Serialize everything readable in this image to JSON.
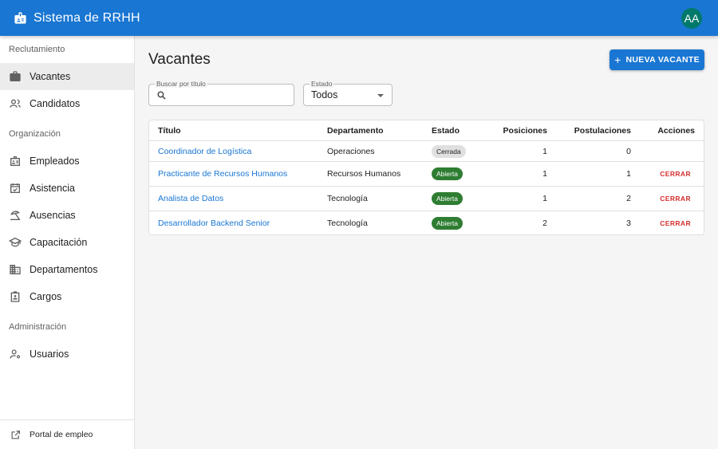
{
  "app": {
    "title": "Sistema de RRHH",
    "user_initials": "AA"
  },
  "sidebar": {
    "sections": [
      {
        "label": "Reclutamiento"
      },
      {
        "label": "Organización"
      },
      {
        "label": "Administración"
      }
    ],
    "items": [
      {
        "label": "Vacantes",
        "icon": "briefcase-icon",
        "active": true
      },
      {
        "label": "Candidatos",
        "icon": "people-icon"
      },
      {
        "label": "Empleados",
        "icon": "id-badge-icon"
      },
      {
        "label": "Asistencia",
        "icon": "calendar-check-icon"
      },
      {
        "label": "Ausencias",
        "icon": "beach-icon"
      },
      {
        "label": "Capacitación",
        "icon": "school-icon"
      },
      {
        "label": "Departamentos",
        "icon": "building-icon"
      },
      {
        "label": "Cargos",
        "icon": "badge-icon"
      },
      {
        "label": "Usuarios",
        "icon": "user-gear-icon"
      }
    ],
    "footer": {
      "label": "Portal de empleo",
      "icon": "external-link-icon"
    }
  },
  "main": {
    "title": "Vacantes",
    "new_button": "NUEVA VACANTE",
    "search": {
      "label": "Buscar por título",
      "value": ""
    },
    "state_filter": {
      "label": "Estado",
      "value": "Todos"
    },
    "table": {
      "columns": [
        "Título",
        "Departamento",
        "Estado",
        "Posiciones",
        "Postulaciones",
        "Acciones"
      ],
      "rows": [
        {
          "title": "Coordinador de Logística",
          "dept": "Operaciones",
          "state": "Cerrada",
          "positions": "1",
          "applications": "0",
          "action": ""
        },
        {
          "title": "Practicante de Recursos Humanos",
          "dept": "Recursos Humanos",
          "state": "Abierta",
          "positions": "1",
          "applications": "1",
          "action": "CERRAR"
        },
        {
          "title": "Analista de Datos",
          "dept": "Tecnología",
          "state": "Abierta",
          "positions": "1",
          "applications": "2",
          "action": "CERRAR"
        },
        {
          "title": "Desarrollador Backend Senior",
          "dept": "Tecnología",
          "state": "Abierta",
          "positions": "2",
          "applications": "3",
          "action": "CERRAR"
        }
      ]
    }
  },
  "colors": {
    "primary": "#1976d2",
    "avatar": "#00796b",
    "open_chip": "#2e7d32",
    "closed_chip": "#e0e0e0",
    "danger": "#d32f2f"
  }
}
